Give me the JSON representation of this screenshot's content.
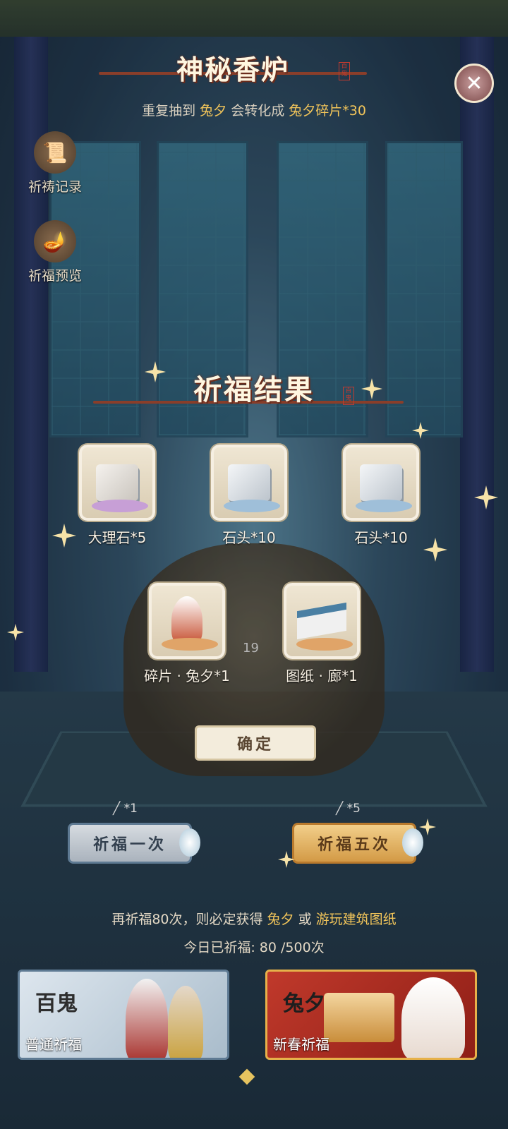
{
  "header": {
    "title": "神秘香炉",
    "seal_text": "百鬼",
    "notice_prefix": "重复抽到",
    "notice_item": "兔夕",
    "notice_mid": "会转化成",
    "notice_result": "兔夕碎片*30"
  },
  "side_buttons": [
    {
      "label": "祈祷记录",
      "icon": "scroll-icon"
    },
    {
      "label": "祈福预览",
      "icon": "incense-icon"
    }
  ],
  "result": {
    "title": "祈福结果",
    "seal_text": "百鬼",
    "items": [
      {
        "label": "大理石*5",
        "icon": "marble-icon"
      },
      {
        "label": "石头*10",
        "icon": "stone-icon"
      },
      {
        "label": "石头*10",
        "icon": "stone-icon"
      },
      {
        "label": "碎片 · 兔夕*1",
        "icon": "rabbit-shard-icon"
      },
      {
        "label": "图纸 · 廊*1",
        "icon": "blueprint-icon"
      }
    ],
    "hidden_count": "19",
    "confirm_label": "确定"
  },
  "pray": {
    "once_cost": "*1",
    "once_label": "祈福一次",
    "five_cost": "*5",
    "five_label": "祈福五次"
  },
  "info": {
    "guarantee_prefix": "再祈福80次，则必定获得",
    "guarantee_item1": "兔夕",
    "guarantee_or": "或",
    "guarantee_item2": "游玩建筑图纸",
    "today_text": "今日已祈福:  80 /500次"
  },
  "banners": {
    "normal": {
      "big": "百鬼",
      "name": "普通祈福"
    },
    "spring": {
      "big": "兔夕",
      "name": "新春祈福"
    }
  },
  "colors": {
    "accent_gold": "#f2c55a",
    "seal_red": "#c03b30"
  }
}
